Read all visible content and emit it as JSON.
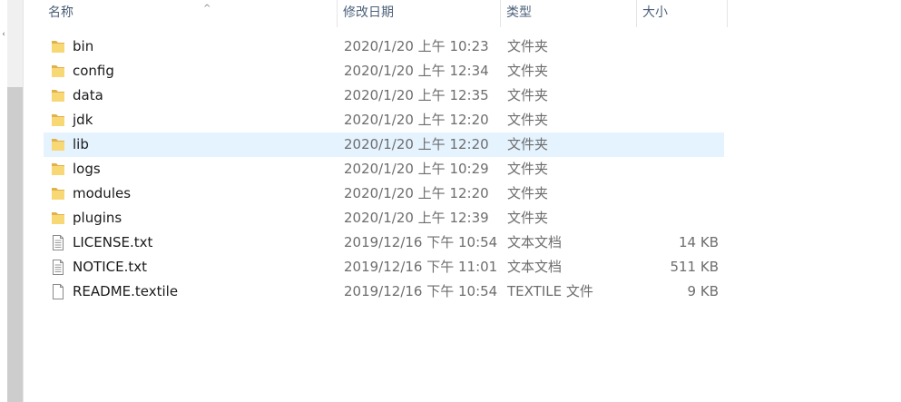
{
  "columns": {
    "name": "名称",
    "modified": "修改日期",
    "type": "类型",
    "size": "大小"
  },
  "files": [
    {
      "name": "bin",
      "modified": "2020/1/20 上午 10:23",
      "type": "文件夹",
      "size": "",
      "icon": "folder-icon"
    },
    {
      "name": "config",
      "modified": "2020/1/20 上午 12:34",
      "type": "文件夹",
      "size": "",
      "icon": "folder-icon"
    },
    {
      "name": "data",
      "modified": "2020/1/20 上午 12:35",
      "type": "文件夹",
      "size": "",
      "icon": "folder-icon"
    },
    {
      "name": "jdk",
      "modified": "2020/1/20 上午 12:20",
      "type": "文件夹",
      "size": "",
      "icon": "folder-icon"
    },
    {
      "name": "lib",
      "modified": "2020/1/20 上午 12:20",
      "type": "文件夹",
      "size": "",
      "icon": "folder-icon",
      "selected": true
    },
    {
      "name": "logs",
      "modified": "2020/1/20 上午 10:29",
      "type": "文件夹",
      "size": "",
      "icon": "folder-icon"
    },
    {
      "name": "modules",
      "modified": "2020/1/20 上午 12:20",
      "type": "文件夹",
      "size": "",
      "icon": "folder-icon"
    },
    {
      "name": "plugins",
      "modified": "2020/1/20 上午 12:39",
      "type": "文件夹",
      "size": "",
      "icon": "folder-icon"
    },
    {
      "name": "LICENSE.txt",
      "modified": "2019/12/16 下午 10:54",
      "type": "文本文档",
      "size": "14 KB",
      "icon": "text-file-icon"
    },
    {
      "name": "NOTICE.txt",
      "modified": "2019/12/16 下午 11:01",
      "type": "文本文档",
      "size": "511 KB",
      "icon": "text-file-icon"
    },
    {
      "name": "README.textile",
      "modified": "2019/12/16 下午 10:54",
      "type": "TEXTILE 文件",
      "size": "9 KB",
      "icon": "blank-file-icon"
    }
  ],
  "colors": {
    "header_text": "#4c607a",
    "selection_bg": "#e5f3ff",
    "folder": "#f8d775",
    "folder_dark": "#e0b24a"
  }
}
